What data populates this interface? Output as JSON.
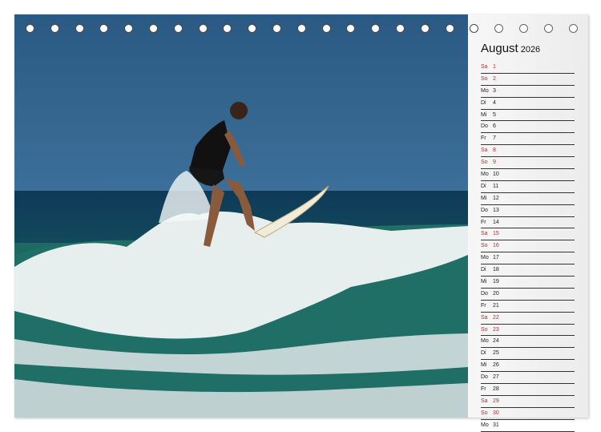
{
  "calendar": {
    "month": "August",
    "year": "2026",
    "days": [
      {
        "wd": "Sa",
        "d": "1",
        "weekend": true
      },
      {
        "wd": "So",
        "d": "2",
        "weekend": true
      },
      {
        "wd": "Mo",
        "d": "3",
        "weekend": false
      },
      {
        "wd": "Di",
        "d": "4",
        "weekend": false
      },
      {
        "wd": "Mi",
        "d": "5",
        "weekend": false
      },
      {
        "wd": "Do",
        "d": "6",
        "weekend": false
      },
      {
        "wd": "Fr",
        "d": "7",
        "weekend": false
      },
      {
        "wd": "Sa",
        "d": "8",
        "weekend": true
      },
      {
        "wd": "So",
        "d": "9",
        "weekend": true
      },
      {
        "wd": "Mo",
        "d": "10",
        "weekend": false
      },
      {
        "wd": "Di",
        "d": "11",
        "weekend": false
      },
      {
        "wd": "Mi",
        "d": "12",
        "weekend": false
      },
      {
        "wd": "Do",
        "d": "13",
        "weekend": false
      },
      {
        "wd": "Fr",
        "d": "14",
        "weekend": false
      },
      {
        "wd": "Sa",
        "d": "15",
        "weekend": true
      },
      {
        "wd": "So",
        "d": "16",
        "weekend": true
      },
      {
        "wd": "Mo",
        "d": "17",
        "weekend": false
      },
      {
        "wd": "Di",
        "d": "18",
        "weekend": false
      },
      {
        "wd": "Mi",
        "d": "19",
        "weekend": false
      },
      {
        "wd": "Do",
        "d": "20",
        "weekend": false
      },
      {
        "wd": "Fr",
        "d": "21",
        "weekend": false
      },
      {
        "wd": "Sa",
        "d": "22",
        "weekend": true
      },
      {
        "wd": "So",
        "d": "23",
        "weekend": true
      },
      {
        "wd": "Mo",
        "d": "24",
        "weekend": false
      },
      {
        "wd": "Di",
        "d": "25",
        "weekend": false
      },
      {
        "wd": "Mi",
        "d": "26",
        "weekend": false
      },
      {
        "wd": "Do",
        "d": "27",
        "weekend": false
      },
      {
        "wd": "Fr",
        "d": "28",
        "weekend": false
      },
      {
        "wd": "Sa",
        "d": "29",
        "weekend": true
      },
      {
        "wd": "So",
        "d": "30",
        "weekend": true
      },
      {
        "wd": "Mo",
        "d": "31",
        "weekend": false
      }
    ]
  },
  "colors": {
    "weekend_text": "#c62828",
    "sky": "#2b5e88",
    "sea": "#0f3d5c",
    "wave_foam": "#eef3f2"
  },
  "photo": {
    "subject": "surfer-on-wave"
  }
}
